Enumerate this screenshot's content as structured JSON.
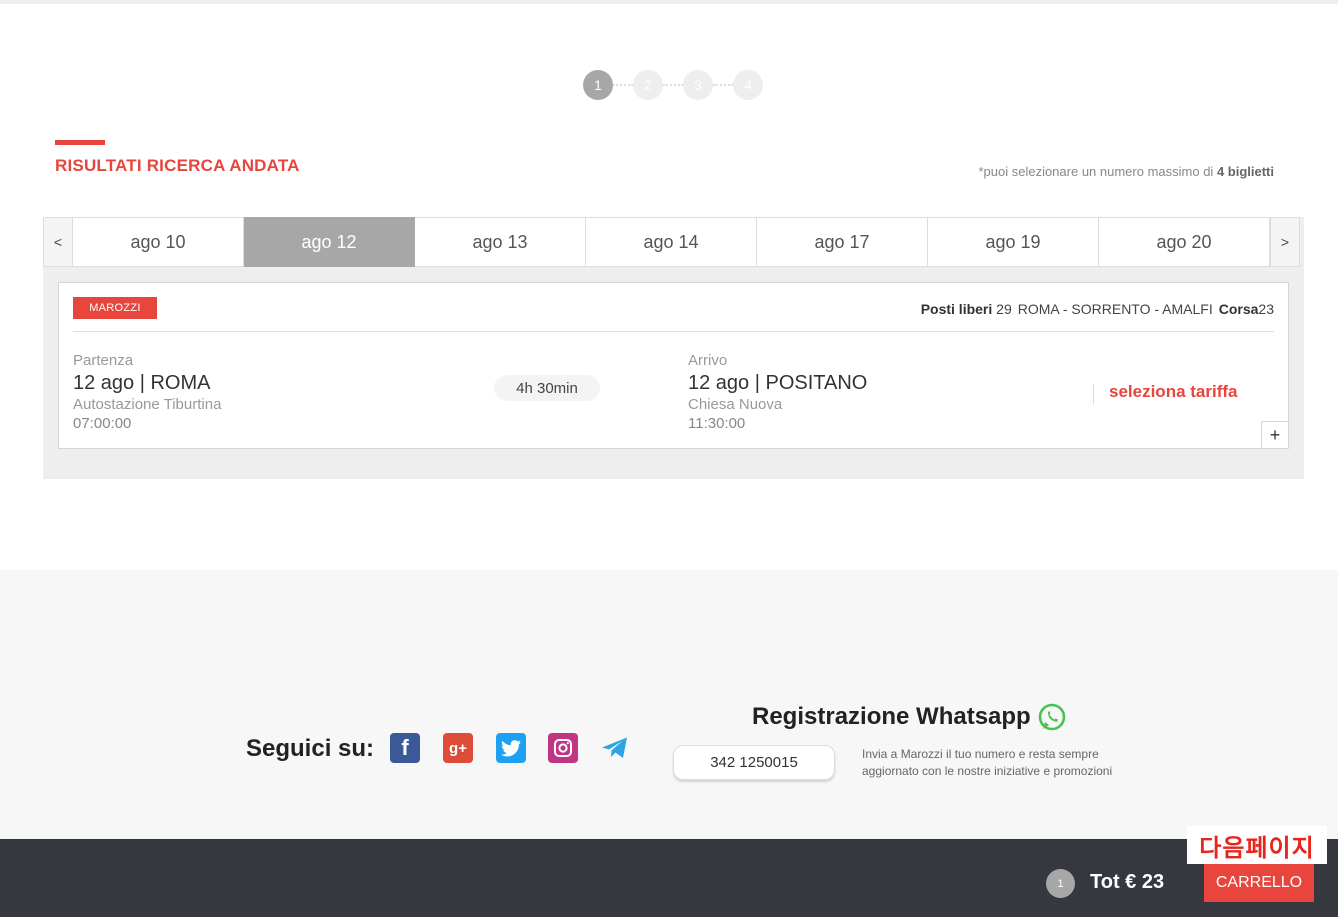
{
  "steps": [
    "1",
    "2",
    "3",
    "4"
  ],
  "active_step": 0,
  "section": {
    "title": "RISULTATI RICERCA ANDATA",
    "note_prefix": "*puoi selezionare un numero massimo di ",
    "note_bold": "4 biglietti"
  },
  "datebar": {
    "prev": "<",
    "next": ">",
    "dates": [
      "ago 10",
      "ago 12",
      "ago 13",
      "ago 14",
      "ago 17",
      "ago 19",
      "ago 20"
    ],
    "active_index": 1
  },
  "result": {
    "operator": "MAROZZI",
    "seats_label": "Posti liberi",
    "seats_value": "29",
    "route": "ROMA - SORRENTO - AMALFI",
    "run_label": "Corsa",
    "run_value": "23",
    "departure": {
      "label": "Partenza",
      "main": "12 ago | ROMA",
      "station": "Autostazione Tiburtina",
      "time": "07:00:00"
    },
    "duration": "4h 30min",
    "arrival": {
      "label": "Arrivo",
      "main": "12 ago | POSITANO",
      "station": "Chiesa Nuova",
      "time": "11:30:00"
    },
    "select_fare": "seleziona tariffa",
    "expand": "+"
  },
  "footer": {
    "follow_label": "Seguici su:",
    "social_icons": [
      "facebook-icon",
      "google-plus-icon",
      "twitter-icon",
      "instagram-icon",
      "telegram-icon"
    ],
    "whatsapp_title": "Registrazione Whatsapp",
    "whatsapp_number": "342 1250015",
    "whatsapp_desc": "Invia a Marozzi il tuo numero e resta sempre aggiornato con le nostre iniziative e promozioni"
  },
  "cart": {
    "count": "1",
    "total": "Tot € 23",
    "button": "CARRELLO"
  },
  "annotation": "다음페이지",
  "colors": {
    "accent": "#e8453c",
    "active_tab": "#a7a7a7",
    "footer_dark": "#363840"
  }
}
